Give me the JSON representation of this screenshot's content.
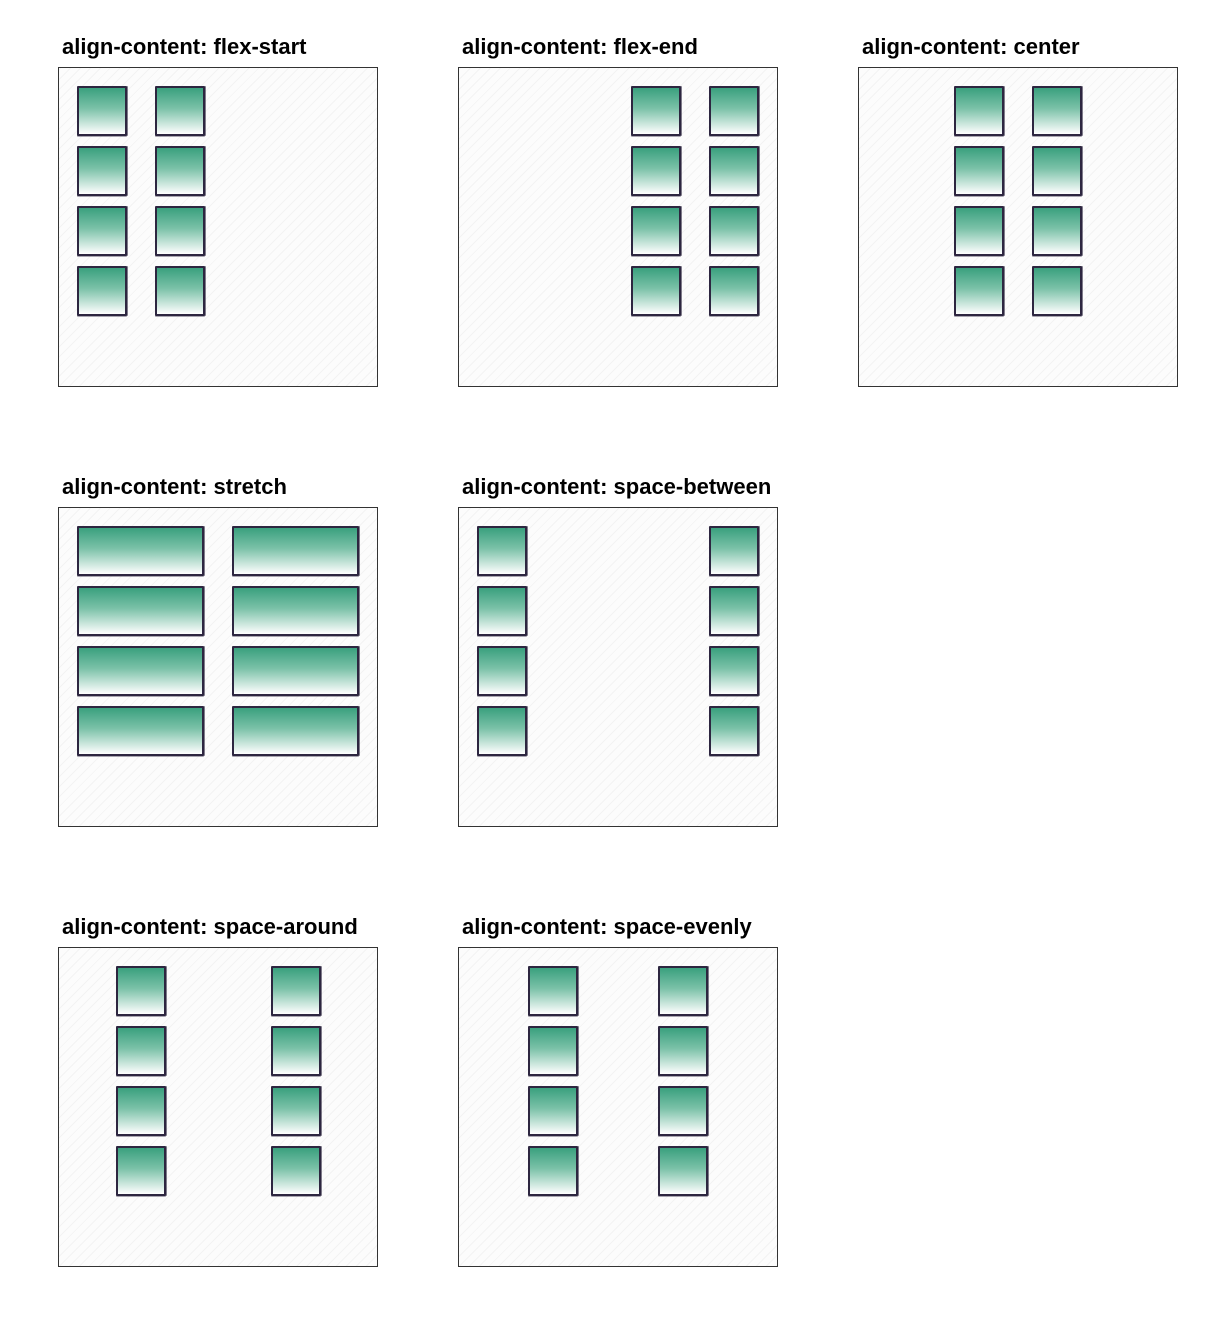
{
  "panels": [
    {
      "title": "align-content: flex-start",
      "value": "flex-start"
    },
    {
      "title": "align-content: flex-end",
      "value": "flex-end"
    },
    {
      "title": "align-content: center",
      "value": "center"
    },
    {
      "title": "align-content: stretch",
      "value": "stretch"
    },
    {
      "title": "align-content: space-between",
      "value": "space-between"
    },
    {
      "title": "align-content: space-around",
      "value": "space-around"
    },
    {
      "title": "align-content: space-evenly",
      "value": "space-evenly"
    }
  ],
  "items_per_container": 8,
  "colors": {
    "item_fill_top": "#3aa07e",
    "item_fill_bottom": "#ffffff",
    "item_border": "#2d2640",
    "container_border": "#333333"
  }
}
